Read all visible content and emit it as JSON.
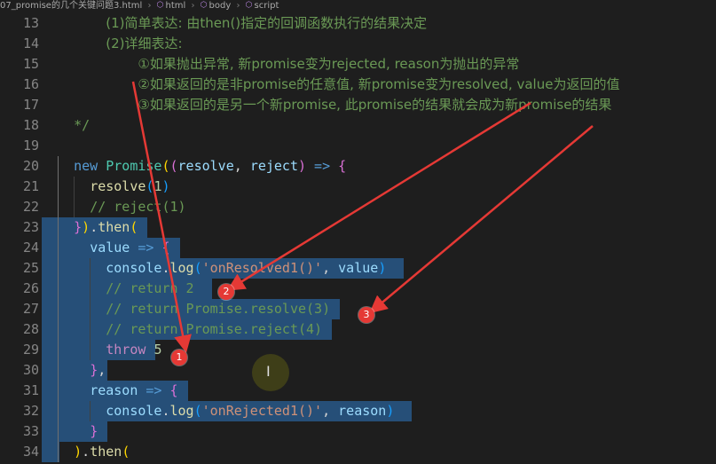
{
  "breadcrumb": {
    "file": "07_promise的几个关键问题3.html",
    "items": [
      "html",
      "body",
      "script"
    ]
  },
  "lines": [
    {
      "n": "13",
      "indent": 4,
      "tokens": [
        {
          "t": "(1)简单表达: 由then()指定的回调函数执行的结果决定",
          "c": "cm zh"
        }
      ]
    },
    {
      "n": "14",
      "indent": 4,
      "tokens": [
        {
          "t": "(2)详细表达:",
          "c": "cm zh"
        }
      ]
    },
    {
      "n": "15",
      "indent": 6,
      "tokens": [
        {
          "t": "①如果抛出异常, 新promise变为rejected, reason为抛出的异常",
          "c": "cm zh"
        }
      ]
    },
    {
      "n": "16",
      "indent": 6,
      "tokens": [
        {
          "t": "②如果返回的是非promise的任意值, 新promise变为resolved, value为返回的值",
          "c": "cm zh"
        }
      ]
    },
    {
      "n": "17",
      "indent": 6,
      "tokens": [
        {
          "t": "③如果返回的是另一个新promise, 此promise的结果就会成为新promise的结果",
          "c": "cm zh"
        }
      ]
    },
    {
      "n": "18",
      "indent": 2,
      "tokens": [
        {
          "t": "*/",
          "c": "cm"
        }
      ]
    },
    {
      "n": "19",
      "indent": 0,
      "tokens": []
    },
    {
      "n": "20",
      "indent": 2,
      "tokens": [
        {
          "t": "new ",
          "c": "kw"
        },
        {
          "t": "Promise",
          "c": "cls"
        },
        {
          "t": "(",
          "c": "br1"
        },
        {
          "t": "(",
          "c": "br2"
        },
        {
          "t": "resolve",
          "c": "param"
        },
        {
          "t": ", ",
          "c": ""
        },
        {
          "t": "reject",
          "c": "param"
        },
        {
          "t": ")",
          "c": "br2"
        },
        {
          "t": " => ",
          "c": "kw"
        },
        {
          "t": "{",
          "c": "br2"
        }
      ]
    },
    {
      "n": "21",
      "indent": 3,
      "tokens": [
        {
          "t": "resolve",
          "c": "fn"
        },
        {
          "t": "(",
          "c": "br3"
        },
        {
          "t": "1",
          "c": "num"
        },
        {
          "t": ")",
          "c": "br3"
        }
      ]
    },
    {
      "n": "22",
      "indent": 3,
      "tokens": [
        {
          "t": "// reject(1)",
          "c": "cm"
        }
      ]
    },
    {
      "n": "23",
      "indent": 2,
      "tokens": [
        {
          "t": "}",
          "c": "br2"
        },
        {
          "t": ")",
          "c": "br1"
        },
        {
          "t": ".",
          "c": ""
        },
        {
          "t": "then",
          "c": "fn"
        },
        {
          "t": "(",
          "c": "br1"
        }
      ]
    },
    {
      "n": "24",
      "indent": 3,
      "tokens": [
        {
          "t": "value",
          "c": "param"
        },
        {
          "t": " => ",
          "c": "kw"
        },
        {
          "t": "{",
          "c": "br2"
        }
      ]
    },
    {
      "n": "25",
      "indent": 4,
      "tokens": [
        {
          "t": "console",
          "c": "param"
        },
        {
          "t": ".",
          "c": ""
        },
        {
          "t": "log",
          "c": "fn"
        },
        {
          "t": "(",
          "c": "br3"
        },
        {
          "t": "'onResolved1()'",
          "c": "str"
        },
        {
          "t": ", ",
          "c": ""
        },
        {
          "t": "value",
          "c": "param"
        },
        {
          "t": ")",
          "c": "br3"
        }
      ]
    },
    {
      "n": "26",
      "indent": 4,
      "tokens": [
        {
          "t": "// return 2",
          "c": "cm"
        }
      ]
    },
    {
      "n": "27",
      "indent": 4,
      "tokens": [
        {
          "t": "// return Promise.resolve(3)",
          "c": "cm"
        }
      ]
    },
    {
      "n": "28",
      "indent": 4,
      "tokens": [
        {
          "t": "// return Promise.reject(4)",
          "c": "cm"
        }
      ]
    },
    {
      "n": "29",
      "indent": 4,
      "tokens": [
        {
          "t": "throw ",
          "c": "ctl"
        },
        {
          "t": "5",
          "c": "num"
        }
      ]
    },
    {
      "n": "30",
      "indent": 3,
      "tokens": [
        {
          "t": "}",
          "c": "br2"
        },
        {
          "t": ",",
          "c": ""
        }
      ]
    },
    {
      "n": "31",
      "indent": 3,
      "tokens": [
        {
          "t": "reason",
          "c": "param"
        },
        {
          "t": " => ",
          "c": "kw"
        },
        {
          "t": "{",
          "c": "br2"
        }
      ]
    },
    {
      "n": "32",
      "indent": 4,
      "tokens": [
        {
          "t": "console",
          "c": "param"
        },
        {
          "t": ".",
          "c": ""
        },
        {
          "t": "log",
          "c": "fn"
        },
        {
          "t": "(",
          "c": "br3"
        },
        {
          "t": "'onRejected1()'",
          "c": "str"
        },
        {
          "t": ", ",
          "c": ""
        },
        {
          "t": "reason",
          "c": "param"
        },
        {
          "t": ")",
          "c": "br3"
        }
      ]
    },
    {
      "n": "33",
      "indent": 3,
      "tokens": [
        {
          "t": "}",
          "c": "br2"
        }
      ]
    },
    {
      "n": "34",
      "indent": 2,
      "tokens": [
        {
          "t": ")",
          "c": "br1"
        },
        {
          "t": ".",
          "c": ""
        },
        {
          "t": "then",
          "c": "fn"
        },
        {
          "t": "(",
          "c": "br1"
        }
      ]
    }
  ],
  "badges": [
    "1",
    "2",
    "3"
  ],
  "colors": {
    "background": "#1e1e1e",
    "selection": "#264f78",
    "annotation": "#e53935"
  }
}
